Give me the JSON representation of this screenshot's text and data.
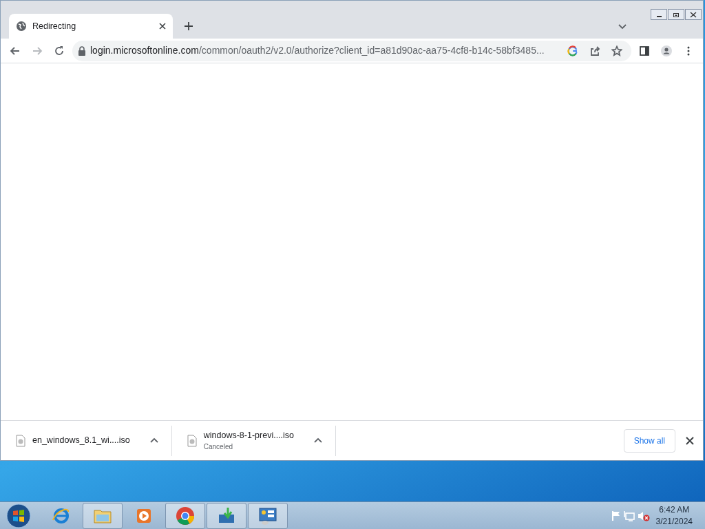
{
  "tabs": [
    {
      "title": "Redirecting",
      "selected": true
    }
  ],
  "address_bar": {
    "host": "login.microsoftonline.com",
    "path": "/common/oauth2/v2.0/authorize?client_id=a81d90ac-aa75-4cf8-b14c-58bf3485..."
  },
  "downloads": [
    {
      "name": "en_windows_8.1_wi....iso"
    },
    {
      "name": "windows-8-1-previ....iso",
      "status": "Canceled"
    }
  ],
  "download_bar": {
    "show_all": "Show all"
  },
  "taskbar": {
    "items": [
      {
        "kind": "ie",
        "running": false
      },
      {
        "kind": "explorer",
        "running": true
      },
      {
        "kind": "media",
        "running": false
      },
      {
        "kind": "chrome",
        "running": true
      },
      {
        "kind": "download",
        "running": true
      },
      {
        "kind": "panel",
        "running": true
      }
    ],
    "time": "6:42 AM",
    "date": "3/21/2024"
  }
}
